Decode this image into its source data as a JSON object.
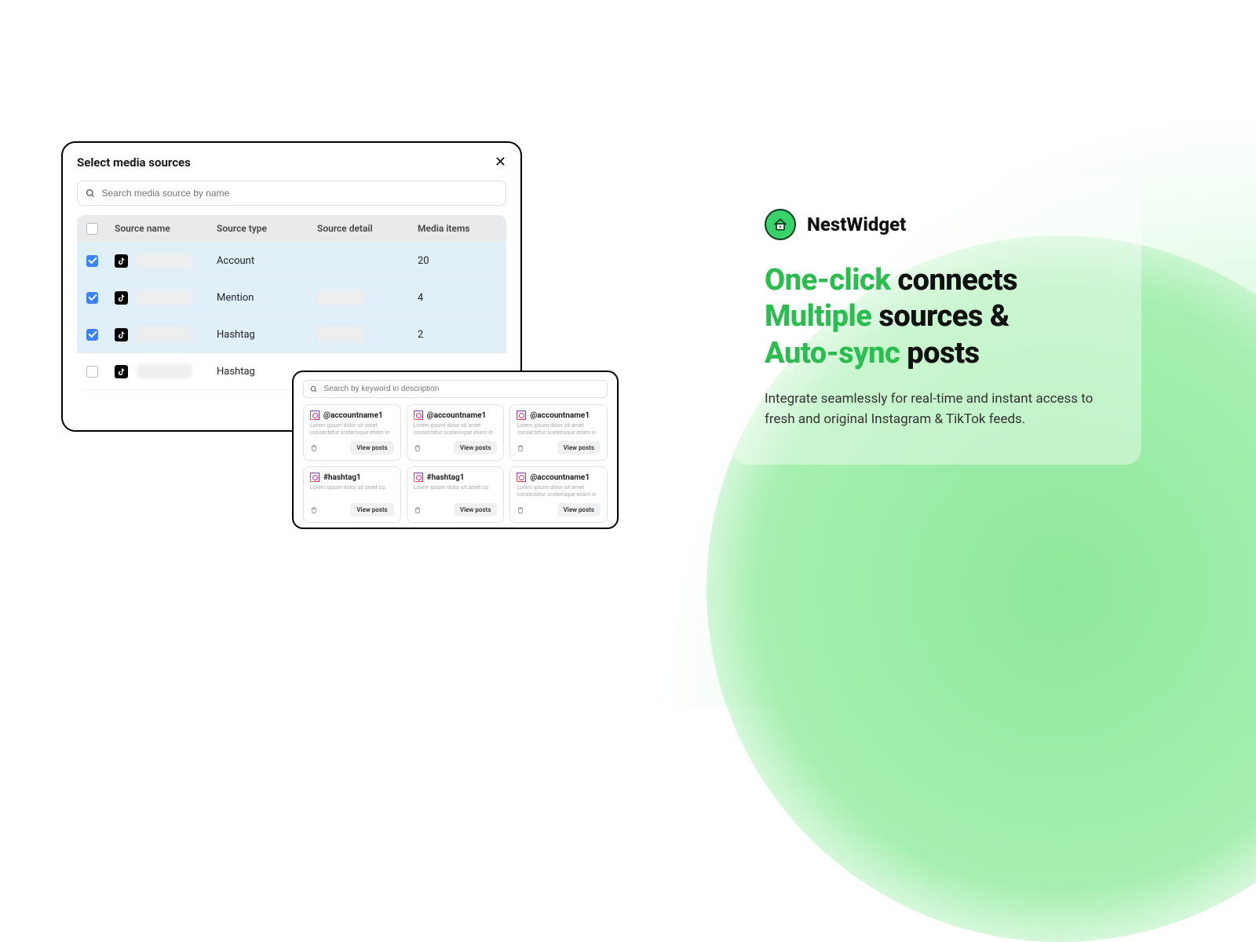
{
  "modal1": {
    "title": "Select media sources",
    "search_placeholder": "Search media source by name",
    "headers": {
      "name": "Source name",
      "type": "Source type",
      "detail": "Source detail",
      "media": "Media items"
    },
    "rows": [
      {
        "checked": true,
        "type": "Account",
        "media": "20"
      },
      {
        "checked": true,
        "type": "Mention",
        "media": "4"
      },
      {
        "checked": true,
        "type": "Hashtag",
        "media": "2"
      },
      {
        "checked": false,
        "type": "Hashtag",
        "media": ""
      }
    ]
  },
  "modal2": {
    "search_placeholder": "Search by keyword in description",
    "lorem": "Lorem ipsum dolor sit amet consectetur scelerisque etiam in mo.",
    "lorem_short": "Lorem ipsum dolor sit amet co.",
    "view_label": "View posts",
    "cards": [
      {
        "handle": "@accountname1",
        "desc_key": "lorem"
      },
      {
        "handle": "@accountname1",
        "desc_key": "lorem"
      },
      {
        "handle": "@accountname1",
        "desc_key": "lorem"
      },
      {
        "handle": "#hashtag1",
        "desc_key": "lorem_short"
      },
      {
        "handle": "#hashtag1",
        "desc_key": "lorem_short"
      },
      {
        "handle": "@accountname1",
        "desc_key": "lorem"
      }
    ]
  },
  "promo": {
    "brand": "NestWidget",
    "hl1_green": "One-click",
    "hl1_rest": " connects",
    "hl2_green": "Multiple",
    "hl2_rest": " sources &",
    "hl3_green": "Auto-sync",
    "hl3_rest": " posts",
    "sub": "Integrate seamlessly for real-time and instant access to fresh and original Instagram & TikTok feeds."
  }
}
